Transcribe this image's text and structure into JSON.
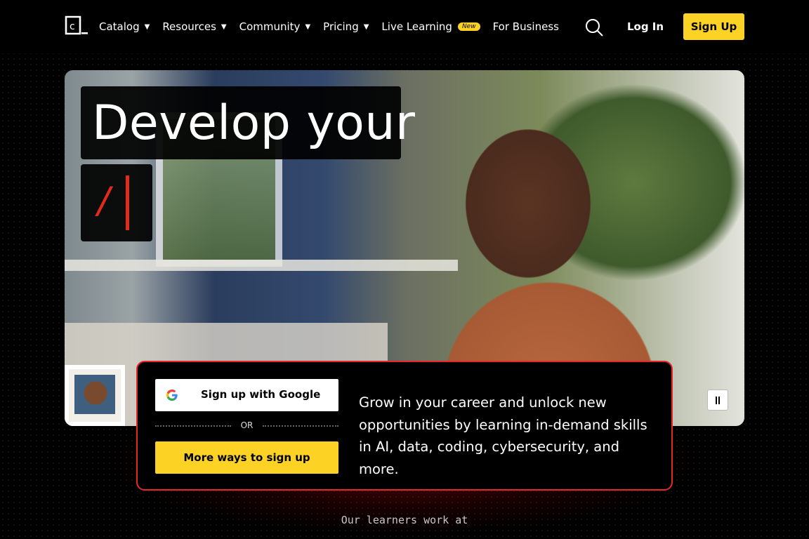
{
  "nav": {
    "logo_alt": "c_",
    "items": [
      {
        "label": "Catalog",
        "has_dropdown": true
      },
      {
        "label": "Resources",
        "has_dropdown": true
      },
      {
        "label": "Community",
        "has_dropdown": true
      },
      {
        "label": "Pricing",
        "has_dropdown": true
      },
      {
        "label": "Live Learning",
        "badge": "New"
      },
      {
        "label": "For Business"
      }
    ],
    "caret": "▼",
    "search_icon": "search-icon",
    "login_label": "Log In",
    "signup_label": "Sign Up"
  },
  "hero": {
    "headline": "Develop your",
    "typing_text": "/",
    "pause_icon": "pause-icon"
  },
  "signup_card": {
    "google_label": "Sign up with Google",
    "or_label": "OR",
    "more_ways_label": "More ways to sign up",
    "copy": "Grow in your career and unlock new opportunities by learning in-demand skills in AI, data, coding, cybersecurity, and more."
  },
  "learners_heading": "Our learners work at",
  "colors": {
    "accent_yellow": "#fcd225",
    "accent_red": "#e5282c",
    "background": "#000000"
  }
}
